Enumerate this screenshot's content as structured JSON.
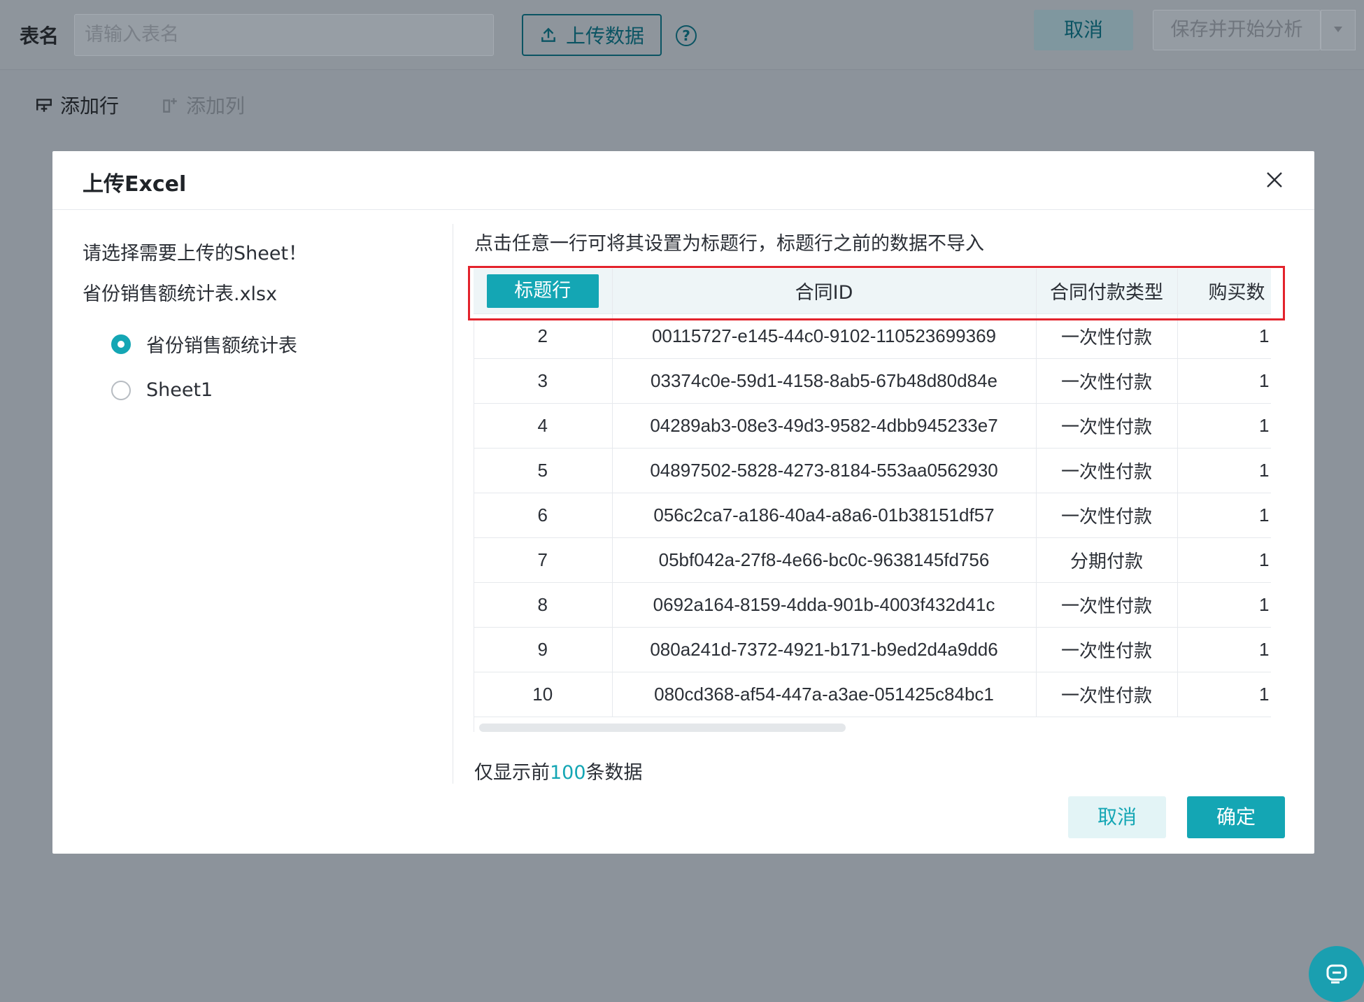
{
  "topbar": {
    "table_name_label": "表名",
    "table_name_placeholder": "请输入表名",
    "upload_label": "上传数据",
    "help_glyph": "?",
    "cancel_label": "取消",
    "save_label": "保存并开始分析"
  },
  "toolbar": {
    "add_row": "添加行",
    "add_col": "添加列"
  },
  "modal": {
    "title": "上传Excel",
    "left": {
      "prompt": "请选择需要上传的Sheet！",
      "file_name": "省份销售额统计表.xlsx",
      "sheets": [
        {
          "label": "省份销售额统计表",
          "selected": true
        },
        {
          "label": "Sheet1",
          "selected": false
        }
      ]
    },
    "instruction": "点击任意一行可将其设置为标题行，标题行之前的数据不导入",
    "table": {
      "header_chip": "标题行",
      "columns": [
        "合同ID",
        "合同付款类型",
        "购买数"
      ],
      "rows": [
        {
          "n": "2",
          "id": "00115727-e145-44c0-9102-110523699369",
          "type": "一次性付款",
          "qty": "1"
        },
        {
          "n": "3",
          "id": "03374c0e-59d1-4158-8ab5-67b48d80d84e",
          "type": "一次性付款",
          "qty": "1"
        },
        {
          "n": "4",
          "id": "04289ab3-08e3-49d3-9582-4dbb945233e7",
          "type": "一次性付款",
          "qty": "1"
        },
        {
          "n": "5",
          "id": "04897502-5828-4273-8184-553aa0562930",
          "type": "一次性付款",
          "qty": "1"
        },
        {
          "n": "6",
          "id": "056c2ca7-a186-40a4-a8a6-01b38151df57",
          "type": "一次性付款",
          "qty": "1"
        },
        {
          "n": "7",
          "id": "05bf042a-27f8-4e66-bc0c-9638145fd756",
          "type": "分期付款",
          "qty": "1"
        },
        {
          "n": "8",
          "id": "0692a164-8159-4dda-901b-4003f432d41c",
          "type": "一次性付款",
          "qty": "1"
        },
        {
          "n": "9",
          "id": "080a241d-7372-4921-b171-b9ed2d4a9dd6",
          "type": "一次性付款",
          "qty": "1"
        },
        {
          "n": "10",
          "id": "080cd368-af54-447a-a3ae-051425c84bc1",
          "type": "一次性付款",
          "qty": "1"
        }
      ]
    },
    "footnote": {
      "prefix": "仅显示前",
      "count": "100",
      "suffix": "条数据"
    },
    "cancel_label": "取消",
    "ok_label": "确定"
  },
  "colors": {
    "accent": "#14a6b4",
    "highlight_box": "#e3232c",
    "overlay": "#8c939b"
  },
  "icons": {
    "upload": "upload-icon",
    "help": "help-circle-icon",
    "add_row": "add-row-icon",
    "add_col": "add-column-icon",
    "close": "close-icon",
    "chat": "chat-support-icon",
    "dropdown": "caret-down-icon"
  }
}
